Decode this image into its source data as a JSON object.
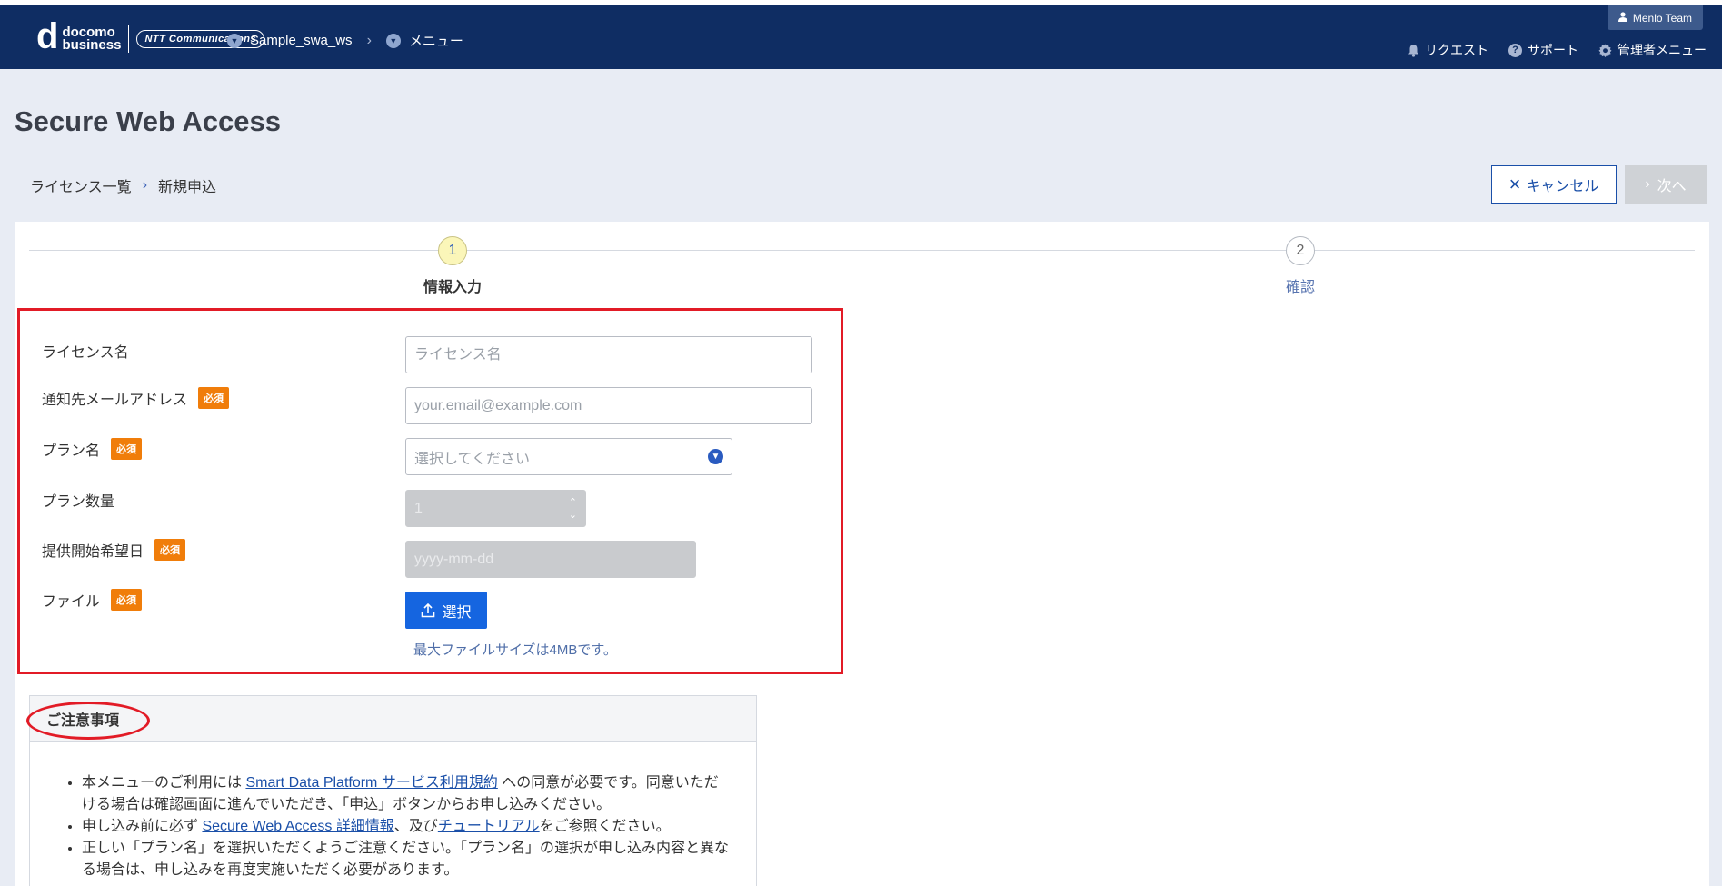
{
  "header": {
    "logo_top": "docomo",
    "logo_bottom": "business",
    "ntt_logo": "NTT Communications",
    "crumb1": "Sample_swa_ws",
    "crumb2": "メニュー",
    "user": "Menlo Team",
    "menu": {
      "request": "リクエスト",
      "support": "サポート",
      "admin": "管理者メニュー"
    }
  },
  "page": {
    "title": "Secure Web Access",
    "breadcrumb": [
      "ライセンス一覧",
      "新規申込"
    ],
    "cancel_label": "キャンセル",
    "next_label": "次へ"
  },
  "steps": [
    {
      "num": "1",
      "label": "情報入力",
      "active": true
    },
    {
      "num": "2",
      "label": "確認",
      "active": false
    }
  ],
  "form": {
    "required_badge": "必須",
    "license_name": {
      "label": "ライセンス名",
      "placeholder": "ライセンス名"
    },
    "email": {
      "label": "通知先メールアドレス",
      "placeholder": "your.email@example.com"
    },
    "plan": {
      "label": "プラン名",
      "placeholder": "選択してください"
    },
    "quantity": {
      "label": "プラン数量",
      "value": "1"
    },
    "start_date": {
      "label": "提供開始希望日",
      "placeholder": "yyyy-mm-dd"
    },
    "file": {
      "label": "ファイル",
      "button": "選択",
      "hint": "最大ファイルサイズは4MBです。"
    }
  },
  "notes": {
    "title": "ご注意事項",
    "item1_pre": "本メニューのご利用には ",
    "item1_link": "Smart Data Platform サービス利用規約",
    "item1_post": " への同意が必要です。同意いただける場合は確認画面に進んでいただき、「申込」ボタンからお申し込みください。",
    "item2_pre": "申し込み前に必ず ",
    "item2_link1": "Secure Web Access 詳細情報",
    "item2_mid": "、及び",
    "item2_link2": "チュートリアル",
    "item2_post": "をご参照ください。",
    "item3": "正しい「プラン名」を選択いただくようご注意ください。「プラン名」の選択が申し込み内容と異なる場合は、申し込みを再度実施いただく必要があります。"
  }
}
